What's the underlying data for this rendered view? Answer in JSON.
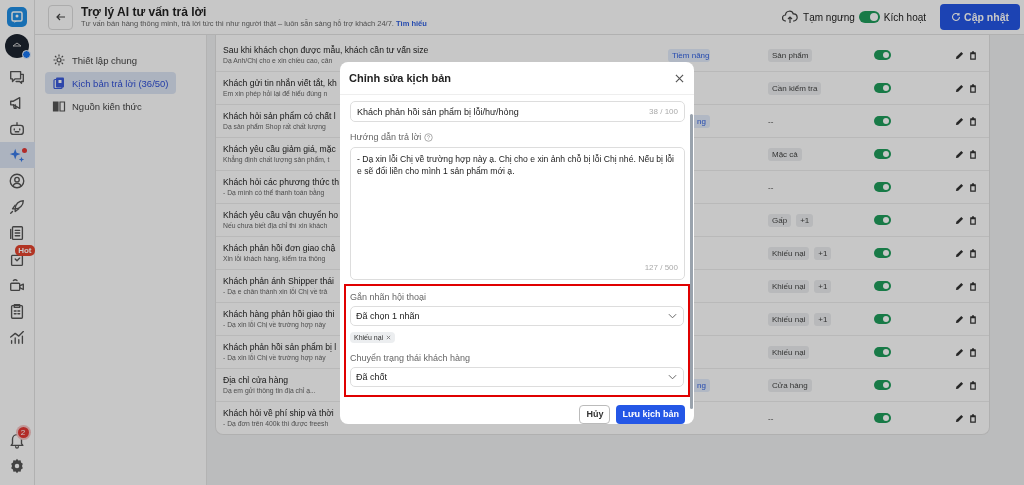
{
  "rail": {
    "items": [
      {
        "selected": false
      },
      {
        "selected": false
      },
      {
        "selected": false
      },
      {
        "selected": true,
        "dot": true
      },
      {
        "selected": false
      },
      {
        "selected": false
      },
      {
        "selected": false
      },
      {
        "selected": false,
        "badge": "Hot"
      },
      {
        "selected": false
      },
      {
        "selected": false
      },
      {
        "selected": false
      }
    ],
    "notifications": {
      "badge": "2"
    }
  },
  "header": {
    "title": "Trợ lý AI tư vấn trả lời",
    "subtitle": "Tư vấn bán hàng thông minh, trả lời tức thì như người thật – luôn sẵn sàng hỗ trợ khách 24/7.",
    "subtitle_link": "Tìm hiểu",
    "pause_label": "Tạm ngưng",
    "toggle": {
      "on": true
    },
    "active_label": "Kích hoạt",
    "update_button": "Cập nhật"
  },
  "nav": {
    "items": [
      {
        "label": "Thiết lập chung",
        "selected": false
      },
      {
        "label": "Kịch bản trả lời (36/50)",
        "selected": true
      },
      {
        "label": "Nguồn kiến thức",
        "selected": false
      }
    ]
  },
  "table": {
    "rows": [
      {
        "title": "Sau khi khách chọn được mẫu, khách cần tư vấn size",
        "description": "Dạ Anh/Chị cho e xin chiều cao, cân",
        "status": "Tiềm năng",
        "tags": [
          "Sản phẩm"
        ],
        "enabled": true
      },
      {
        "title": "Khách gửi tin nhắn viết tắt, kh",
        "description": "Em xin phép hỏi lại để hiểu đúng n",
        "tags": [
          "Cần kiểm tra"
        ],
        "enabled": true
      },
      {
        "title": "Khách hỏi sản phẩm có chất l",
        "description": "Dạ sản phẩm Shop rất chất lượng",
        "status": "ng",
        "tags": [
          "--"
        ],
        "enabled": true
      },
      {
        "title": "Khách yêu cầu giảm giá, mặc",
        "description": "Khẳng định chất lượng sản phẩm, t",
        "tags": [
          "Mặc cả"
        ],
        "enabled": true
      },
      {
        "title": "Khách hỏi các phương thức th",
        "description": "- Dạ mình có thể thanh toán bằng",
        "tags": [
          "--"
        ],
        "enabled": true
      },
      {
        "title": "Khách yêu cầu vận chuyển ho",
        "description": "Nếu chưa biết địa chỉ thì xin khách",
        "tags": [
          "Gấp"
        ],
        "extra": "+1",
        "enabled": true
      },
      {
        "title": "Khách phản hồi đơn giao chậ",
        "description": "Xin lỗi khách hàng, kiểm tra thông",
        "tags": [
          "Khiếu nại"
        ],
        "extra": "+1",
        "enabled": true
      },
      {
        "title": "Khách phản ánh Shipper thái",
        "description": "- Dạ e chân thành xin lỗi Chị về trả",
        "tags": [
          "Khiếu nại"
        ],
        "extra": "+1",
        "enabled": true
      },
      {
        "title": "Khách hàng phản hồi giao thi",
        "description": "- Dạ xin lỗi Chị về trường hợp này",
        "tags": [
          "Khiếu nại"
        ],
        "extra": "+1",
        "enabled": true
      },
      {
        "title": "Khách phản hồi sản phẩm bị l",
        "description": "- Dạ xin lỗi Chị về trường hợp này",
        "tags": [
          "Khiếu nại"
        ],
        "enabled": true
      },
      {
        "title": "Địa chỉ cửa hàng",
        "description": "Dạ em gửi thông tin địa chỉ ạ...",
        "status": "ng",
        "tags": [
          "Cửa hàng"
        ],
        "enabled": true
      },
      {
        "title": "Khách hỏi về phí ship và thời",
        "description": "- Dạ đơn trên 400k thì được freesh",
        "tags": [
          "--"
        ],
        "enabled": true
      }
    ]
  },
  "modal": {
    "title": "Chỉnh sửa kịch bản",
    "name_field": {
      "value": "Khách phản hồi sản phẩm bị lỗi/hư/hỏng",
      "count": "38 / 100"
    },
    "guide_field": {
      "label": "Hướng dẫn trả lời",
      "value": "- Dạ xin lỗi Chị về trường hợp này ạ. Chị cho e xin ảnh chỗ bị lỗi Chị nhé. Nếu bị lỗi e sẽ đổi liền cho mình 1 sản phẩm mới ạ.",
      "count": "127 / 500"
    },
    "label_field": {
      "label": "Gắn nhãn hội thoại",
      "value": "Đã chọn 1 nhãn",
      "chips": [
        "Khiếu nại"
      ]
    },
    "status_field": {
      "label": "Chuyển trạng thái khách hàng",
      "value": "Đã chốt"
    },
    "buttons": {
      "cancel": "Hủy",
      "save": "Lưu kịch bản"
    }
  }
}
